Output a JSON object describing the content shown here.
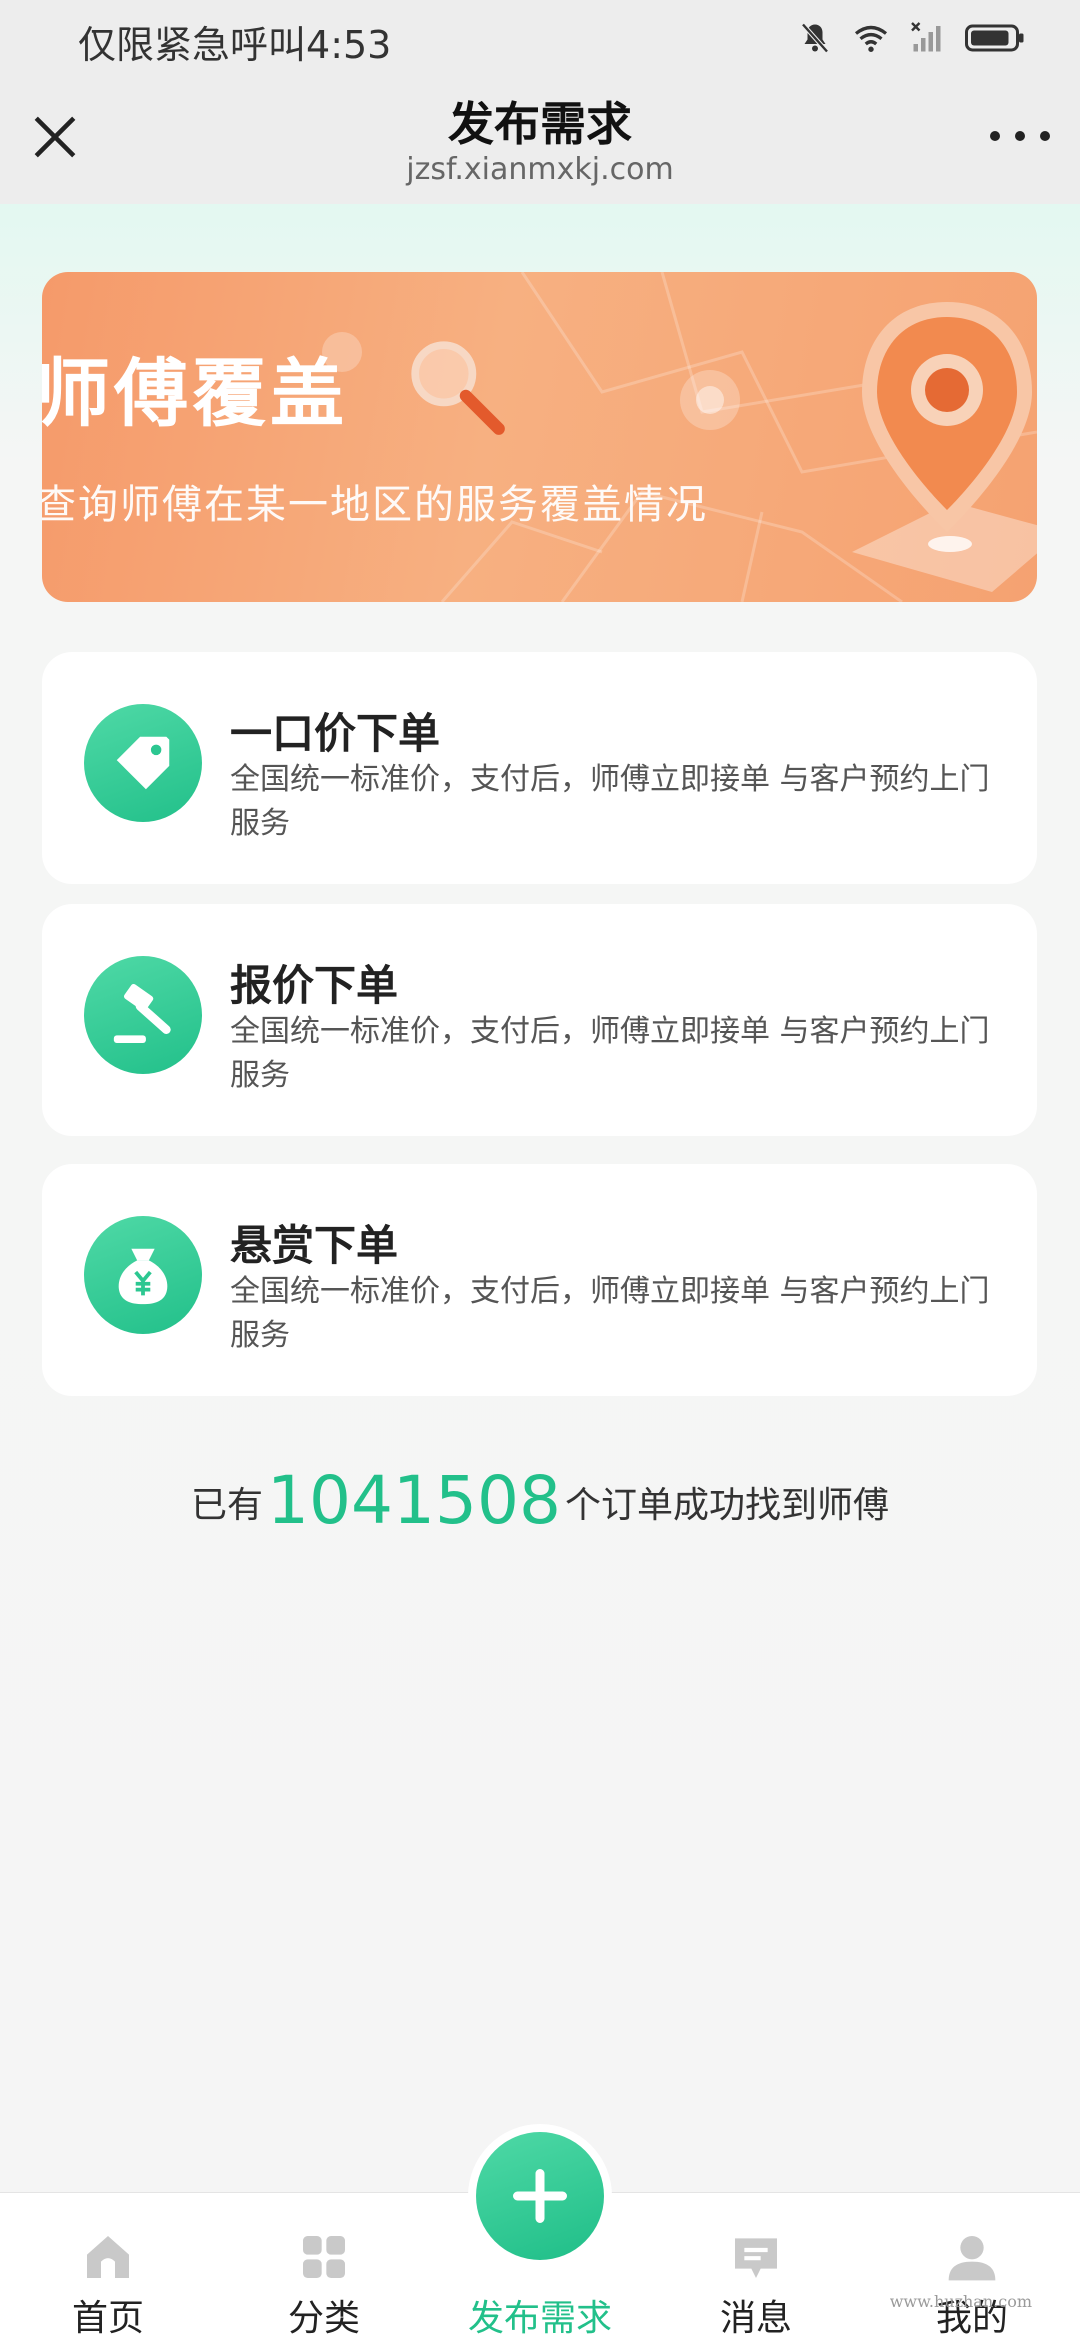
{
  "status_bar": {
    "carrier_text": "仅限紧急呼叫",
    "time": "4:53"
  },
  "header": {
    "title": "发布需求",
    "url": "jzsf.xianmxkj.com"
  },
  "banner": {
    "title": "师傅覆盖",
    "subtitle": "查询师傅在某一地区的服务覆盖情况"
  },
  "order_options": [
    {
      "title": "一口价下单",
      "description": "全国统一标准价，支付后，师傅立即接单 与客户预约上门服务",
      "icon": "price-tag-icon"
    },
    {
      "title": "报价下单",
      "description": "全国统一标准价，支付后，师傅立即接单 与客户预约上门服务",
      "icon": "gavel-icon"
    },
    {
      "title": "悬赏下单",
      "description": "全国统一标准价，支付后，师傅立即接单 与客户预约上门服务",
      "icon": "money-bag-icon"
    }
  ],
  "order_count": {
    "prefix": "已有",
    "number": "1041508",
    "suffix": "个订单成功找到师傅"
  },
  "bottom_nav": {
    "items": [
      {
        "label": "首页",
        "icon": "home-icon"
      },
      {
        "label": "分类",
        "icon": "grid-icon"
      },
      {
        "label": "发布需求",
        "icon": "plus-icon",
        "active": true
      },
      {
        "label": "消息",
        "icon": "message-icon"
      },
      {
        "label": "我的",
        "icon": "user-icon"
      }
    ]
  },
  "watermark": "www.huzhan.com",
  "colors": {
    "accent": "#22c08a",
    "banner_orange": "#f59a6a"
  }
}
